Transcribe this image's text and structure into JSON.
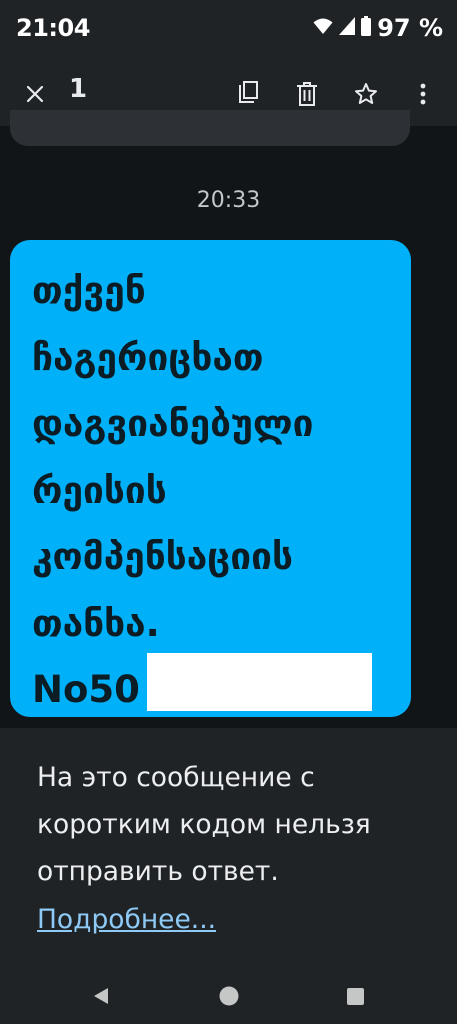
{
  "status_bar": {
    "time": "21:04",
    "battery": "97 %",
    "icons": [
      "wifi-icon",
      "signal-icon",
      "battery-icon"
    ]
  },
  "toolbar": {
    "close_icon": "close-icon",
    "selected_count": "1",
    "actions": [
      "copy-icon",
      "delete-icon",
      "star-icon",
      "more-vert-icon"
    ]
  },
  "conversation": {
    "timestamp": "20:33",
    "message": {
      "lines": [
        "თქვენ",
        "ჩაგერიცხათ",
        "დაგვიანებული",
        "რეისის",
        "კომპენსაციის",
        "თანხა.",
        "No50"
      ]
    }
  },
  "notice": {
    "text": "На это сообщение с коротким кодом нельзя отправить ответ.",
    "link": "Подробнее..."
  },
  "nav_bar": {
    "icons": [
      "back-icon",
      "home-icon",
      "recents-icon"
    ]
  },
  "colors": {
    "bubble": "#00b0f8",
    "background": "#111518",
    "panel": "#1f2326",
    "link": "#8ecaf5"
  }
}
